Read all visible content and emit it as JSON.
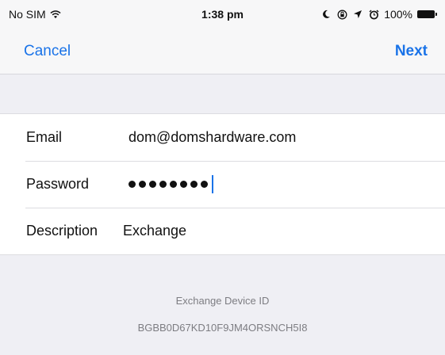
{
  "status_bar": {
    "carrier": "No SIM",
    "time": "1:38 pm",
    "battery": "100%",
    "icons": [
      "wifi-icon",
      "moon-icon",
      "lock-rotation-icon",
      "location-icon",
      "alarm-icon",
      "battery-icon"
    ]
  },
  "nav": {
    "cancel_label": "Cancel",
    "next_label": "Next",
    "accent": "#1a73e8"
  },
  "form": {
    "email_label": "Email",
    "email_value": "dom@domshardware.com",
    "password_label": "Password",
    "password_dots": 8,
    "description_label": "Description",
    "description_value": "Exchange"
  },
  "footer": {
    "title": "Exchange Device ID",
    "device_id": "BGBB0D67KD10F9JM4ORSNCH5I8"
  }
}
